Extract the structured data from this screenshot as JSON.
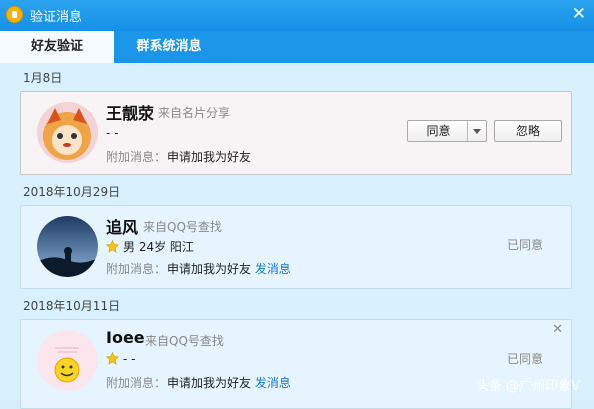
{
  "window": {
    "title": "验证消息"
  },
  "tabs": [
    {
      "label": "好友验证"
    },
    {
      "label": "群系统消息"
    }
  ],
  "requests": [
    {
      "date": "1月8日",
      "name": "王靓荥",
      "source": "来自名片分享",
      "info": "-   -",
      "note_label": "附加消息：",
      "note": "申请加我为好友",
      "accept_label": "同意",
      "ignore_label": "忽略"
    },
    {
      "date": "2018年10月29日",
      "name": "追风",
      "source": "来自QQ号查找",
      "info": "男  24岁  阳江",
      "note_label": "附加消息：",
      "note": "申请加我为好友",
      "send_link": "发消息",
      "status": "已同意"
    },
    {
      "date": "2018年10月11日",
      "name": "Ioee",
      "source": "来自QQ号查找",
      "info": "-   -",
      "note_label": "附加消息：",
      "note": "申请加我为好友",
      "send_link": "发消息",
      "status": "已同意"
    }
  ],
  "watermark": "头条 @广州印象V"
}
